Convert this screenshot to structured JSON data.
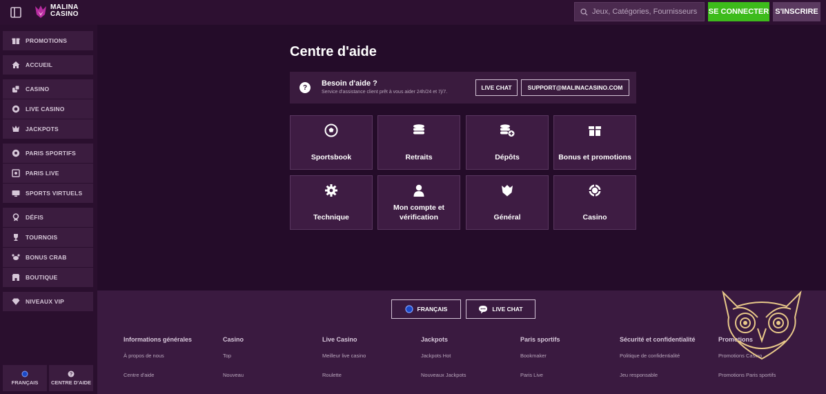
{
  "header": {
    "brand_line1": "MALINA",
    "brand_line2": "CASINO",
    "search_placeholder": "Jeux, Catégories, Fournisseurs",
    "login_label": "SE CONNECTER",
    "register_label": "S'INSCRIRE"
  },
  "sidebar": {
    "groups": [
      [
        {
          "label": "PROMOTIONS",
          "icon": "gift-icon"
        }
      ],
      [
        {
          "label": "ACCUEIL",
          "icon": "home-icon"
        }
      ],
      [
        {
          "label": "CASINO",
          "icon": "dice-icon"
        },
        {
          "label": "LIVE CASINO",
          "icon": "chip-icon"
        },
        {
          "label": "JACKPOTS",
          "icon": "jackpot-icon"
        }
      ],
      [
        {
          "label": "PARIS SPORTIFS",
          "icon": "football-icon"
        },
        {
          "label": "PARIS LIVE",
          "icon": "live-icon"
        },
        {
          "label": "SPORTS VIRTUELS",
          "icon": "virtual-sports-icon"
        }
      ],
      [
        {
          "label": "DÉFIS",
          "icon": "medal-icon"
        },
        {
          "label": "TOURNOIS",
          "icon": "trophy-icon"
        },
        {
          "label": "BONUS CRAB",
          "icon": "crab-icon"
        },
        {
          "label": "BOUTIQUE",
          "icon": "shop-icon"
        }
      ],
      [
        {
          "label": "NIVEAUX VIP",
          "icon": "diamond-icon"
        }
      ]
    ],
    "bottom_language": "FRANÇAIS",
    "bottom_help": "CENTRE D'AIDE"
  },
  "main": {
    "title": "Centre d'aide",
    "help_title": "Besoin d'aide ?",
    "help_sub": "Service d'assistance client prêt à vous aider 24h/24 et 7j/7.",
    "live_chat_label": "LIVE CHAT",
    "email_label": "SUPPORT@MALINACASINO.COM",
    "tiles": [
      {
        "label": "Sportsbook",
        "icon": "football-icon"
      },
      {
        "label": "Retraits",
        "icon": "coins-icon"
      },
      {
        "label": "Dépôts",
        "icon": "coins-add-icon"
      },
      {
        "label": "Bonus et promotions",
        "icon": "gift-icon"
      },
      {
        "label": "Technique",
        "icon": "gear-icon"
      },
      {
        "label": "Mon compte et vérification",
        "icon": "user-icon"
      },
      {
        "label": "Général",
        "icon": "crest-icon"
      },
      {
        "label": "Casino",
        "icon": "chip-icon"
      }
    ]
  },
  "footer": {
    "language_label": "FRANÇAIS",
    "live_chat_label": "LIVE CHAT",
    "columns": [
      {
        "head": "Informations générales",
        "links": [
          "À propos de nous",
          "Centre d'aide"
        ]
      },
      {
        "head": "Casino",
        "links": [
          "Top",
          "Nouveau"
        ]
      },
      {
        "head": "Live Casino",
        "links": [
          "Meilleur live casino",
          "Roulette"
        ]
      },
      {
        "head": "Jackpots",
        "links": [
          "Jackpots Hot",
          "Nouveaux Jackpots"
        ]
      },
      {
        "head": "Paris sportifs",
        "links": [
          "Bookmaker",
          "Paris Live"
        ]
      },
      {
        "head": "Sécurité et confidentialité",
        "links": [
          "Politique de confidentialité",
          "Jeu responsable"
        ]
      },
      {
        "head": "Promotions",
        "links": [
          "Promotions Casino",
          "Promotions Paris sportifs"
        ]
      }
    ]
  },
  "colors": {
    "accent_green": "#3dbb1b",
    "sidebar_item": "#3b1c3f",
    "main_bg": "#240c29",
    "footer_bg": "#3a1a40",
    "owl_gold": "#e9c98a"
  }
}
